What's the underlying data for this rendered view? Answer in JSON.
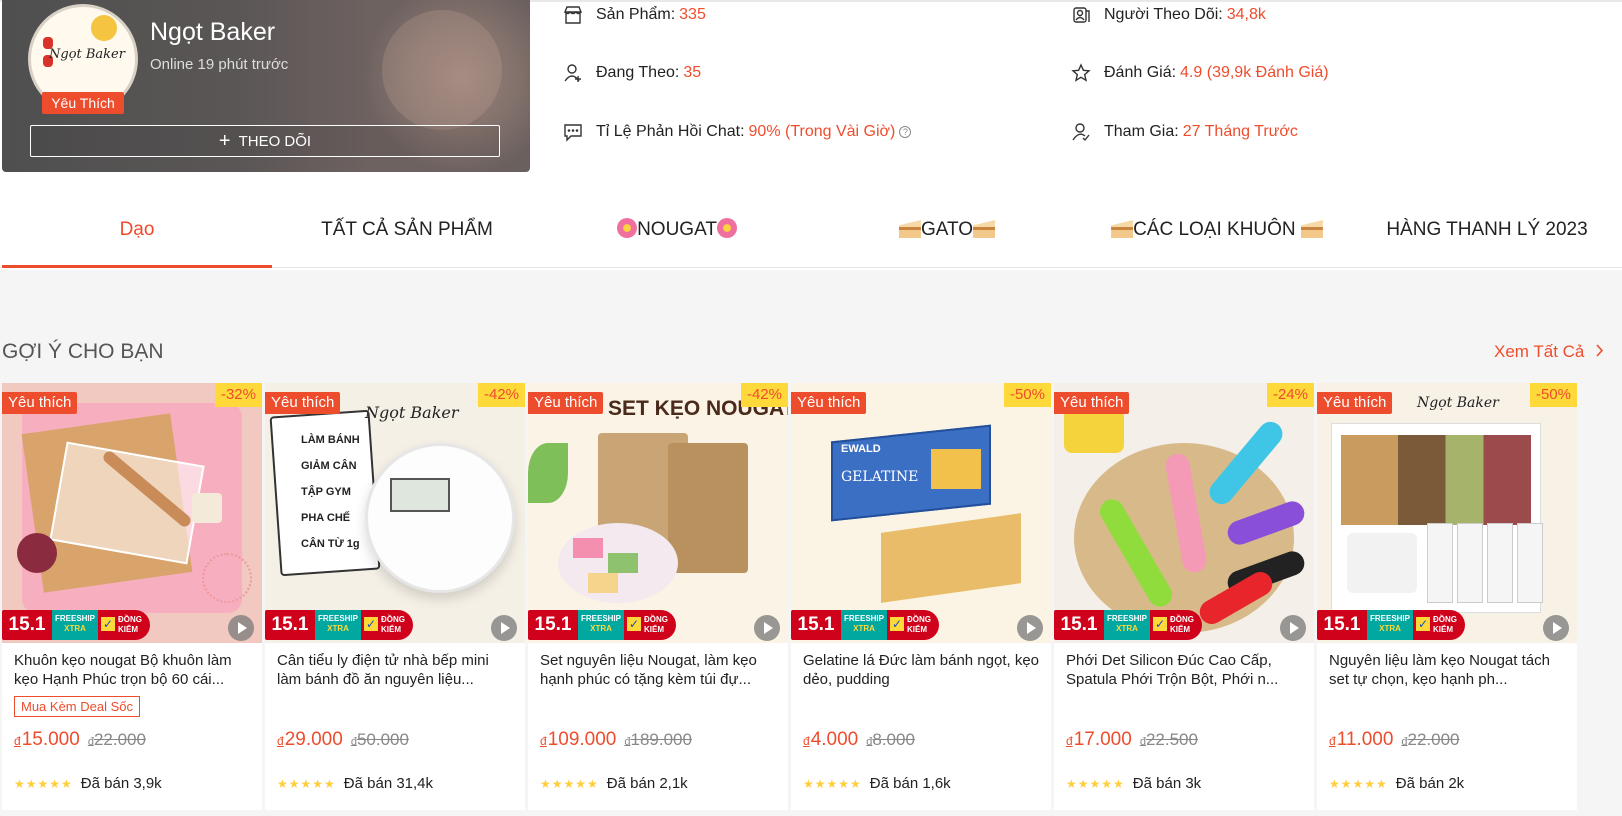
{
  "shop": {
    "name": "Ngọt Baker",
    "online": "Online 19 phút trước",
    "favorite_badge": "Yêu Thích",
    "follow_label": "THEO DÕI",
    "logo_text": "Ngọt Baker"
  },
  "stats": [
    {
      "label": "Sản Phẩm:",
      "value": "335",
      "icon": "store-icon"
    },
    {
      "label": "Người Theo Dõi:",
      "value": "34,8k",
      "icon": "followers-icon"
    },
    {
      "label": "Đang Theo:",
      "value": "35",
      "icon": "add-user-icon"
    },
    {
      "label": "Đánh Giá:",
      "value": "4.9 (39,9k Đánh Giá)",
      "icon": "star-icon"
    },
    {
      "label": "Tỉ Lệ Phản Hồi Chat:",
      "value": "90% (Trong Vài Giờ)",
      "icon": "chat-icon"
    },
    {
      "label": "Tham Gia:",
      "value": "27 Tháng Trước",
      "icon": "user-check-icon"
    }
  ],
  "tabs": [
    {
      "label": "Dạo",
      "active": true
    },
    {
      "label": "TẤT CẢ SẢN PHẨM"
    },
    {
      "label": "NOUGAT"
    },
    {
      "label": "GATO"
    },
    {
      "label": "CÁC LOẠI KHUÔN "
    },
    {
      "label": "HÀNG THANH LÝ 2023"
    }
  ],
  "suggestions": {
    "title": "GỢI Ý CHO BẠN",
    "see_all": "Xem Tất Cả"
  },
  "promo": {
    "date": "15.1",
    "freeship_line1": "FREESHIP",
    "freeship_line2": "XTRA",
    "dongkiem_line1": "ĐỒNG",
    "dongkiem_line2": "KIỂM"
  },
  "products": [
    {
      "fav": "Yêu thích",
      "discount": "-32%",
      "name": "Khuôn kẹo nougat Bộ khuôn làm kẹo Hạnh Phúc trọn bộ 60 cái...",
      "deal": "Mua Kèm Deal Sốc",
      "currency": "đ",
      "price": "15.000",
      "old_price": "22.000",
      "sold": "Đã bán 3,9k"
    },
    {
      "fav": "Yêu thích",
      "discount": "-42%",
      "name": "Cân tiểu ly điện tử nhà bếp mini làm bánh đồ ăn nguyên liệu...",
      "deal": "",
      "currency": "đ",
      "price": "29.000",
      "old_price": "50.000",
      "sold": "Đã bán 31,4k"
    },
    {
      "fav": "Yêu thích",
      "discount": "-42%",
      "name": "Set nguyên liệu Nougat, làm kẹo hạnh phúc có tặng kèm túi đự...",
      "deal": "",
      "currency": "đ",
      "price": "109.000",
      "old_price": "189.000",
      "sold": "Đã bán 2,1k"
    },
    {
      "fav": "Yêu thích",
      "discount": "-50%",
      "name": "Gelatine lá Đức làm bánh ngọt, kẹo dẻo, pudding",
      "deal": "",
      "currency": "đ",
      "price": "4.000",
      "old_price": "8.000",
      "sold": "Đã bán 1,6k"
    },
    {
      "fav": "Yêu thích",
      "discount": "-24%",
      "name": "Phới Det Silicon Đúc Cao Cấp, Spatula Phới Trộn Bột, Phới n...",
      "deal": "",
      "currency": "đ",
      "price": "17.000",
      "old_price": "22.500",
      "sold": "Đã bán 3k"
    },
    {
      "fav": "Yêu thích",
      "discount": "-50%",
      "name": "Nguyên liệu làm kẹo Nougat tách set tự chọn, kẹo hạnh ph...",
      "deal": "",
      "currency": "đ",
      "price": "11.000",
      "old_price": "22.000",
      "sold": "Đã bán 2k"
    }
  ],
  "image_text": {
    "p2_lines": [
      "LÀM BÁNH",
      "GIẢM CÂN TẬP GYM",
      "PHA CHẾ",
      "CÂN TỪ 1g"
    ],
    "p3_banner": "SET KẸO NOUGAT",
    "p4_brand": "EWALD",
    "p4_product": "GELATINE"
  },
  "colors": {
    "accent": "#ee4d2d",
    "badge_yellow": "#ffd839",
    "star": "#ffce3d"
  }
}
